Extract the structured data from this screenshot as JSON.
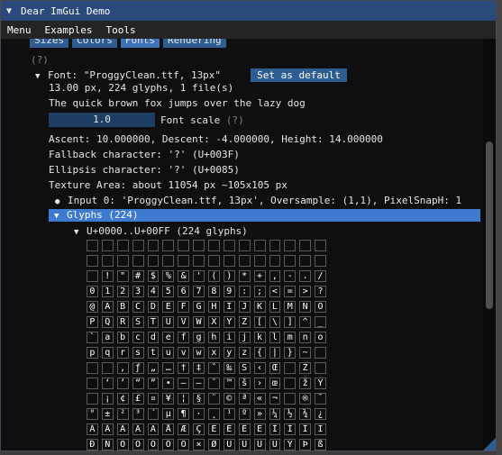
{
  "window": {
    "title": "Dear ImGui Demo"
  },
  "menubar": {
    "items": [
      "Menu",
      "Examples",
      "Tools"
    ]
  },
  "tabs": [
    {
      "label": "Sizes",
      "active": false
    },
    {
      "label": "Colors",
      "active": false
    },
    {
      "label": "Fonts",
      "active": true
    },
    {
      "label": "Rendering",
      "active": false
    }
  ],
  "help_marker": "(?)",
  "font": {
    "tree_label": "Font: \"ProggyClean.ttf, 13px\"",
    "set_default_label": "Set as default",
    "summary": "13.00 px, 224 glyphs, 1 file(s)",
    "sample_text": "The quick brown fox jumps over the lazy dog",
    "scale_value": "1.0",
    "scale_label": "Font scale",
    "metrics": "Ascent: 10.000000, Descent: -4.000000, Height: 14.000000",
    "fallback": "Fallback character: '?' (U+003F)",
    "ellipsis": "Ellipsis character: '?' (U+0085)",
    "texture": "Texture Area: about 11054 px ~105x105 px",
    "input": "Input 0: 'ProggyClean.ttf, 13px', Oversample: (1,1), PixelSnapH: 1",
    "glyphs_header": "Glyphs (224)",
    "range_label": "U+0000..U+00FF (224 glyphs)"
  },
  "glyph_rows": [
    [
      "",
      "",
      "",
      "",
      "",
      "",
      "",
      "",
      "",
      "",
      "",
      "",
      "",
      "",
      "",
      ""
    ],
    [
      "",
      "",
      "",
      "",
      "",
      "",
      "",
      "",
      "",
      "",
      "",
      "",
      "",
      "",
      "",
      ""
    ],
    [
      "",
      "!",
      "\"",
      "#",
      "$",
      "%",
      "&",
      "'",
      "(",
      ")",
      "*",
      "+",
      ",",
      "-",
      ".",
      "/"
    ],
    [
      "0",
      "1",
      "2",
      "3",
      "4",
      "5",
      "6",
      "7",
      "8",
      "9",
      ":",
      ";",
      "<",
      "=",
      ">",
      "?"
    ],
    [
      "@",
      "A",
      "B",
      "C",
      "D",
      "E",
      "F",
      "G",
      "H",
      "I",
      "J",
      "K",
      "L",
      "M",
      "N",
      "O"
    ],
    [
      "P",
      "Q",
      "R",
      "S",
      "T",
      "U",
      "V",
      "W",
      "X",
      "Y",
      "Z",
      "[",
      "\\",
      "]",
      "^",
      "_"
    ],
    [
      "`",
      "a",
      "b",
      "c",
      "d",
      "e",
      "f",
      "g",
      "h",
      "i",
      "j",
      "k",
      "l",
      "m",
      "n",
      "o"
    ],
    [
      "p",
      "q",
      "r",
      "s",
      "t",
      "u",
      "v",
      "w",
      "x",
      "y",
      "z",
      "{",
      "|",
      "}",
      "~",
      ""
    ],
    [
      "",
      "",
      "‚",
      "ƒ",
      "„",
      "…",
      "†",
      "‡",
      "ˆ",
      "‰",
      "Š",
      "‹",
      "Œ",
      "",
      "Ž",
      ""
    ],
    [
      "",
      "‘",
      "’",
      "“",
      "”",
      "•",
      "–",
      "—",
      "˜",
      "™",
      "š",
      "›",
      "œ",
      "",
      "ž",
      "Ÿ"
    ],
    [
      "",
      "¡",
      "¢",
      "£",
      "¤",
      "¥",
      "¦",
      "§",
      "¨",
      "©",
      "ª",
      "«",
      "¬",
      "",
      "®",
      "¯"
    ],
    [
      "°",
      "±",
      "²",
      "³",
      "´",
      "µ",
      "¶",
      "·",
      "¸",
      "¹",
      "º",
      "»",
      "¼",
      "½",
      "¾",
      "¿"
    ],
    [
      "À",
      "Á",
      "Â",
      "Ã",
      "Ä",
      "Å",
      "Æ",
      "Ç",
      "È",
      "É",
      "Ê",
      "Ë",
      "Ì",
      "Í",
      "Î",
      "Ï"
    ],
    [
      "Ð",
      "Ñ",
      "Ò",
      "Ó",
      "Ô",
      "Õ",
      "Ö",
      "×",
      "Ø",
      "Ù",
      "Ú",
      "Û",
      "Ü",
      "Ý",
      "Þ",
      "ß"
    ]
  ],
  "colors": {
    "title_bg": "#294a7a",
    "header_selected": "#3e7ad0",
    "button": "#2e5d92",
    "window_bg": "#0f0f11"
  }
}
